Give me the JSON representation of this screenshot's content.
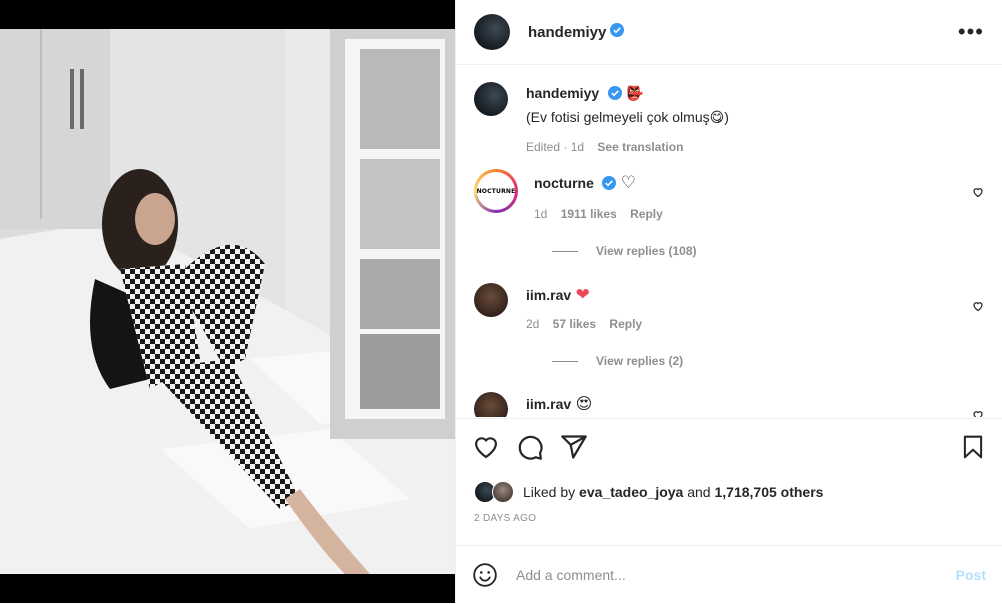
{
  "post": {
    "author": "handemiyy",
    "caption": "(Ev fotisi gelmeyeli çok olmuş😋)",
    "caption_emoji": "👺",
    "caption_meta": {
      "edited": "Edited · 1d",
      "see_translation": "See translation"
    }
  },
  "comments": [
    {
      "user": "nocturne",
      "avatar_text": "NOCTURNE",
      "badge": "♡",
      "time": "1d",
      "likes": "1911 likes",
      "reply": "Reply",
      "view_replies": "View replies (108)"
    },
    {
      "user": "iim.rav",
      "badge": "❤",
      "time": "2d",
      "likes": "57 likes",
      "reply": "Reply",
      "view_replies": "View replies (2)"
    },
    {
      "user": "iim.rav",
      "badge": "😍"
    }
  ],
  "likes": {
    "prefix": "Liked by",
    "user": "eva_tadeo_joya",
    "and": "and",
    "others": "1,718,705 others"
  },
  "timestamp": "2 DAYS AGO",
  "add_comment": {
    "placeholder": "Add a comment...",
    "post_label": "Post"
  },
  "colors": {
    "verified": "#3897f0",
    "link_muted": "#8e8e8e",
    "post_disabled": "#b2dffc",
    "heart_red": "#ed4956"
  }
}
